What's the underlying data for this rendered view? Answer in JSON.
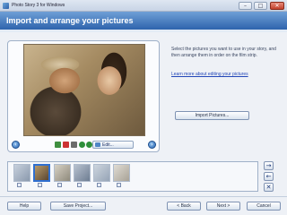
{
  "window": {
    "title": "Photo Story 3 for Windows"
  },
  "header": {
    "title": "Import and arrange your pictures"
  },
  "instructions": {
    "text": "Select the pictures you want to use in your story, and then arrange them in order on the film strip.",
    "learn_link": "Learn more about editing your pictures"
  },
  "import_button": "Import Pictures...",
  "edit_button": "Edit...",
  "footer": {
    "help": "Help",
    "save_project": "Save Project...",
    "back": "< Back",
    "next": "Next >",
    "cancel": "Cancel"
  },
  "film_arrows": {
    "forward": "→",
    "back": "←",
    "delete": "✕"
  },
  "colors": {
    "header_top": "#6f9fd6",
    "header_bottom": "#2e63ad",
    "accent": "#2f6fd0"
  }
}
